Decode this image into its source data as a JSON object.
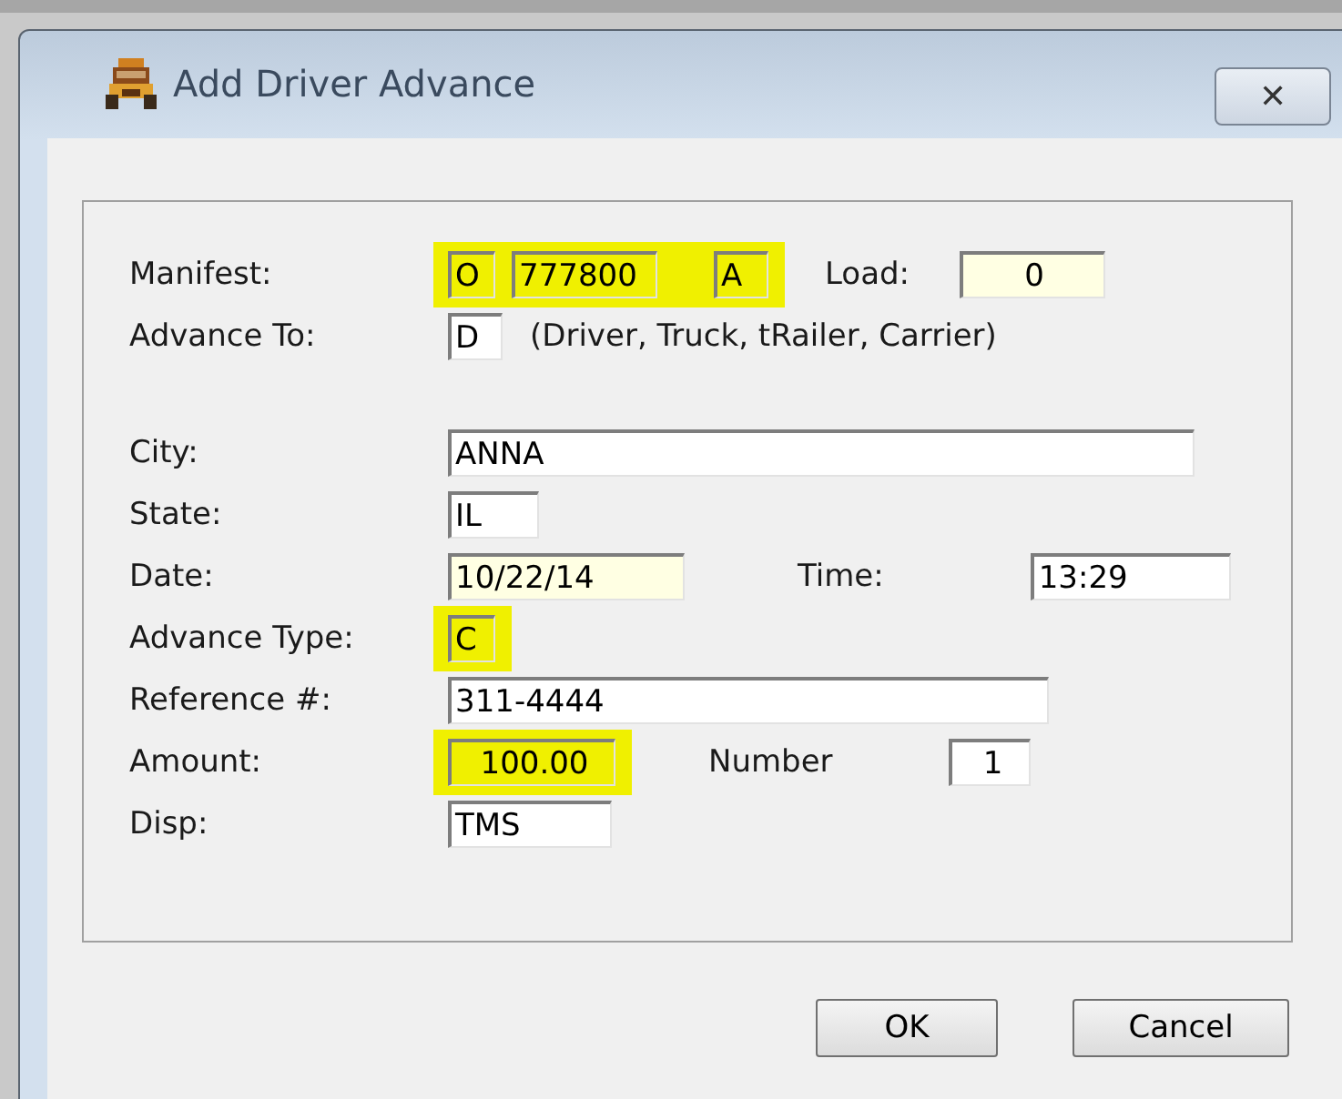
{
  "window": {
    "title": "Add Driver Advance",
    "close": "✕"
  },
  "rows": [
    {
      "label": "Manifest:",
      "items": [
        {
          "kind": "field",
          "value": "O",
          "highlighted": true
        },
        {
          "kind": "field",
          "value": "777800",
          "highlighted": true
        },
        {
          "kind": "field",
          "value": "A",
          "highlighted": true
        },
        {
          "kind": "label",
          "text": "Load:"
        },
        {
          "kind": "field",
          "value": "0",
          "highlighted": false,
          "tinted": true
        }
      ]
    },
    {
      "label": "Advance To:",
      "items": [
        {
          "kind": "field",
          "value": "D",
          "highlighted": false,
          "tinted": false
        },
        {
          "kind": "note",
          "text": "(Driver, Truck, tRailer, Carrier)"
        }
      ]
    },
    {
      "label": "City:",
      "items": [
        {
          "kind": "field",
          "value": "ANNA",
          "highlighted": false,
          "tinted": false
        }
      ]
    },
    {
      "label": "State:",
      "items": [
        {
          "kind": "field",
          "value": "IL",
          "highlighted": false,
          "tinted": false
        }
      ]
    },
    {
      "label": "Date:",
      "items": [
        {
          "kind": "field",
          "value": "10/22/14",
          "highlighted": false,
          "tinted": true
        },
        {
          "kind": "label",
          "text": "Time:"
        },
        {
          "kind": "field",
          "value": "13:29",
          "highlighted": false,
          "tinted": false
        }
      ]
    },
    {
      "label": "Advance Type:",
      "items": [
        {
          "kind": "field",
          "value": "C",
          "highlighted": true
        }
      ]
    },
    {
      "label": "Reference #:",
      "items": [
        {
          "kind": "field",
          "value": "311-4444",
          "highlighted": false,
          "tinted": false
        }
      ]
    },
    {
      "label": "Amount:",
      "items": [
        {
          "kind": "field",
          "value": "100.00",
          "highlighted": true
        },
        {
          "kind": "label",
          "text": "Number"
        },
        {
          "kind": "field",
          "value": "1",
          "highlighted": false,
          "tinted": false
        }
      ]
    },
    {
      "label": "Disp:",
      "items": [
        {
          "kind": "field",
          "value": "TMS",
          "highlighted": false,
          "tinted": false
        }
      ]
    }
  ],
  "buttons": [
    {
      "label": "OK"
    },
    {
      "label": "Cancel"
    }
  ]
}
